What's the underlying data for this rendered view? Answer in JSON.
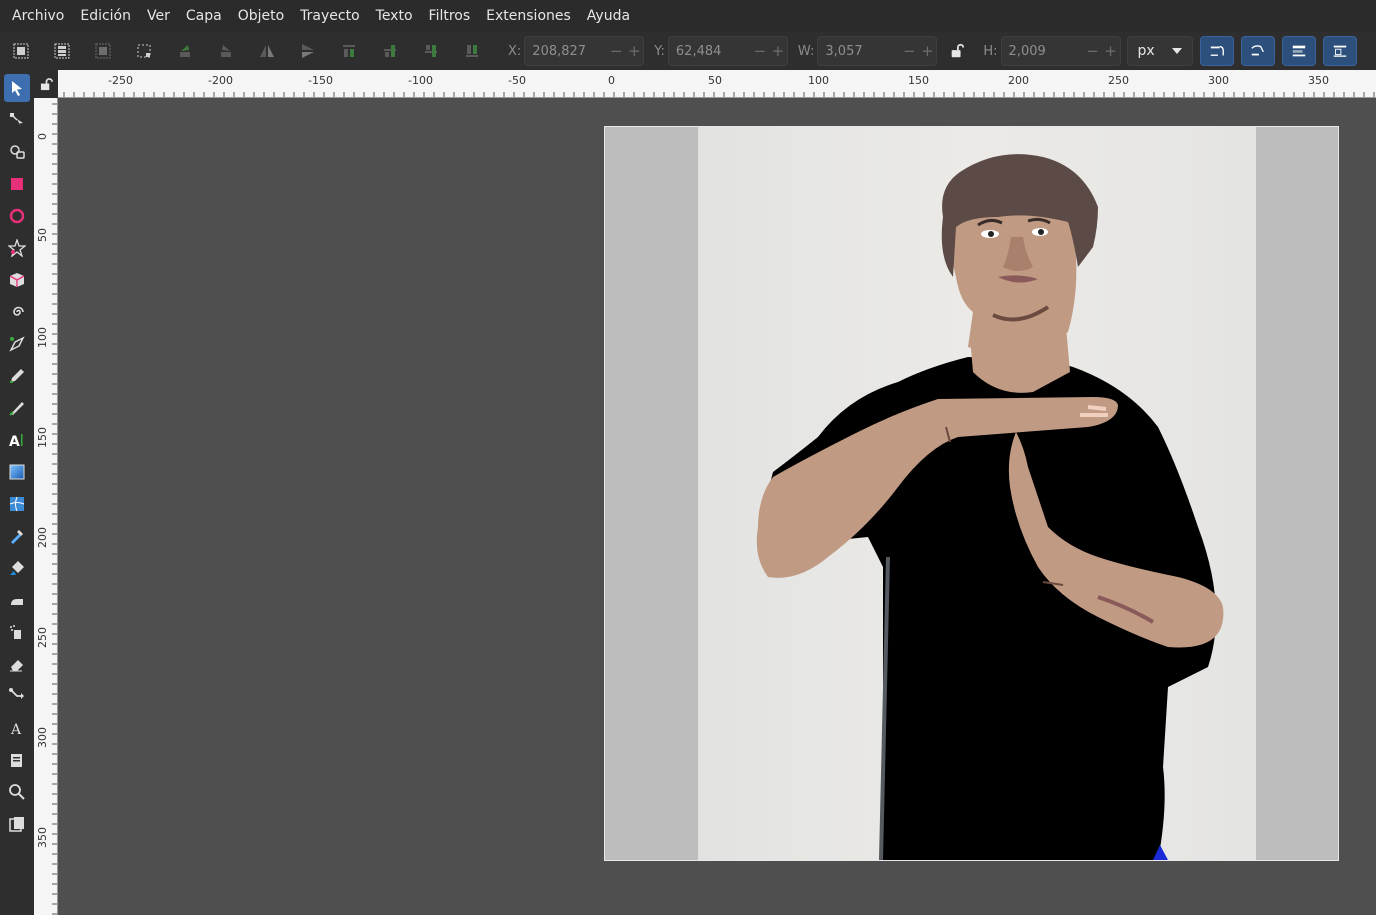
{
  "menu": {
    "items": [
      "Archivo",
      "Edición",
      "Ver",
      "Capa",
      "Objeto",
      "Trayecto",
      "Texto",
      "Filtros",
      "Extensiones",
      "Ayuda"
    ]
  },
  "controls": {
    "x_label": "X:",
    "x_value": "208,827",
    "y_label": "Y:",
    "y_value": "62,484",
    "w_label": "W:",
    "w_value": "3,057",
    "h_label": "H:",
    "h_value": "2,009",
    "unit": "px"
  },
  "ruler_top": {
    "ticks": [
      "-250",
      "-200",
      "-150",
      "-100",
      "-50",
      "0",
      "50",
      "100",
      "150",
      "200",
      "250",
      "300",
      "350"
    ]
  },
  "ruler_left": {
    "ticks": [
      "0",
      "50",
      "100",
      "150",
      "200",
      "250",
      "300",
      "350"
    ]
  },
  "colors": {
    "accent": "#3d6fb0",
    "snap_button": "#2d4f7c",
    "canvas_bg": "#4f4f4f",
    "page_bg": "#bdbdbd",
    "shirt": "#000000",
    "skin": "#c19a83",
    "hair": "#5b4a45"
  },
  "tools": [
    "selector-icon",
    "node-icon",
    "tweak-icon",
    "rectangle-icon",
    "circle-icon",
    "star-icon",
    "box3d-icon",
    "spiral-icon",
    "pen-icon",
    "pencil-icon",
    "calligraphy-icon",
    "text-icon",
    "gradient-icon",
    "mesh-icon",
    "dropper-icon",
    "paint-bucket-icon",
    "spray-icon",
    "spray2-icon",
    "eraser-icon",
    "connector-icon",
    "text-tool-a-icon",
    "pages-icon",
    "zoom-icon",
    "measure-icon"
  ]
}
